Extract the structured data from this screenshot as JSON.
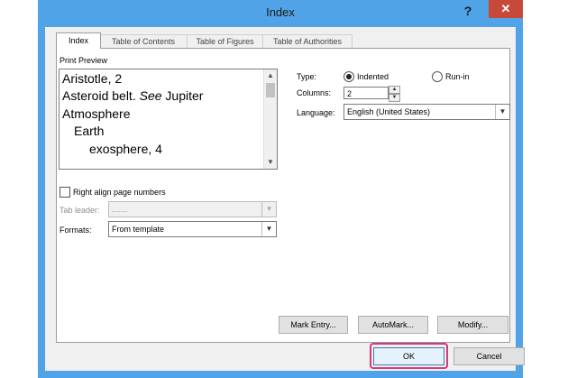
{
  "window": {
    "title": "Index",
    "help_label": "?",
    "close_label": "✕"
  },
  "tabs": [
    {
      "label": "Index",
      "active": true
    },
    {
      "label": "Table of Contents",
      "active": false
    },
    {
      "label": "Table of Figures",
      "active": false
    },
    {
      "label": "Table of Authorities",
      "active": false
    }
  ],
  "print_preview": {
    "label": "Print Preview",
    "lines": [
      {
        "text": "Aristotle, 2"
      },
      {
        "text": "Asteroid belt. ",
        "see": "See",
        "see_target": " Jupiter"
      },
      {
        "text": "Atmosphere"
      },
      {
        "text": "Earth"
      },
      {
        "text": "exosphere, 4"
      }
    ]
  },
  "type": {
    "label": "Type:",
    "options": [
      {
        "label": "Indented",
        "selected": true
      },
      {
        "label": "Run-in",
        "selected": false
      }
    ]
  },
  "columns": {
    "label": "Columns:",
    "value": "2"
  },
  "language": {
    "label": "Language:",
    "value": "English (United States)"
  },
  "right_align": {
    "label": "Right align page numbers",
    "checked": false
  },
  "tab_leader": {
    "label": "Tab leader:",
    "value": ".......",
    "disabled": true
  },
  "formats": {
    "label": "Formats:",
    "value": "From template"
  },
  "buttons": {
    "mark_entry": "Mark Entry...",
    "automark": "AutoMark...",
    "modify": "Modify...",
    "ok": "OK",
    "cancel": "Cancel"
  },
  "colors": {
    "title_bar": "#4fa3e6",
    "close_button": "#c7493a",
    "ok_highlight": "#d43a7d"
  }
}
